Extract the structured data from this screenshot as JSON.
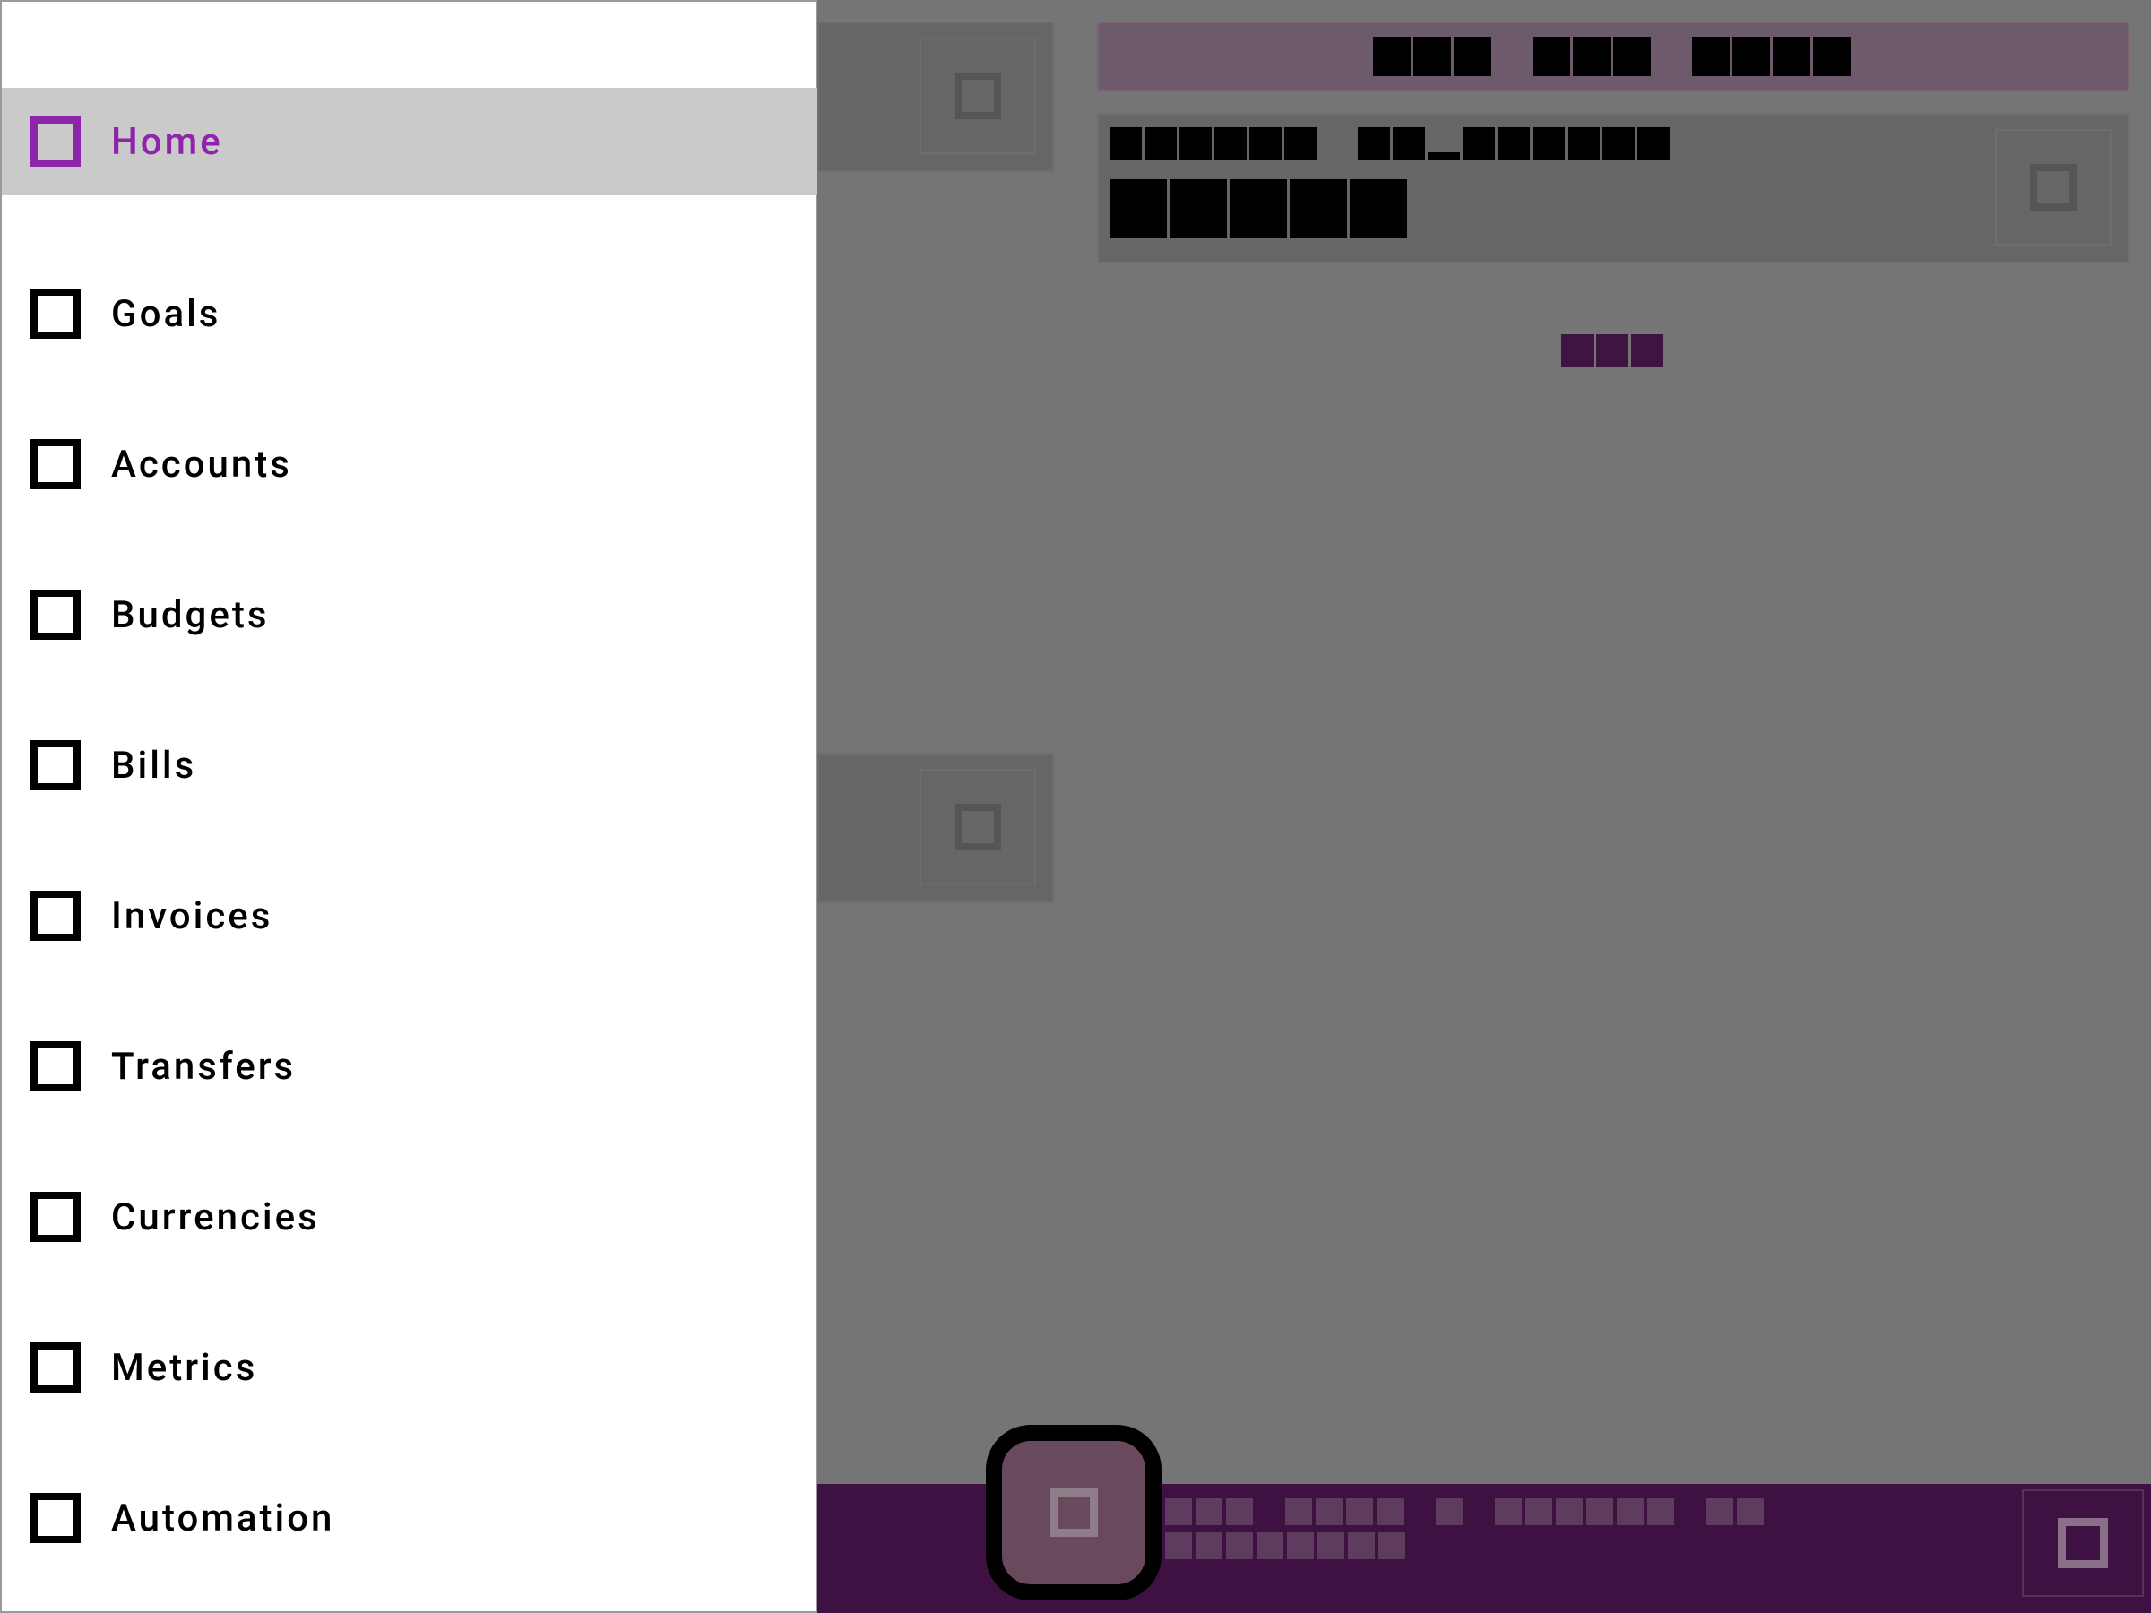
{
  "drawer": {
    "items": [
      {
        "label": "Home",
        "active": true
      },
      {
        "label": "Goals"
      },
      {
        "label": "Accounts"
      },
      {
        "label": "Budgets"
      },
      {
        "label": "Bills"
      },
      {
        "label": "Invoices"
      },
      {
        "label": "Transfers"
      },
      {
        "label": "Currencies"
      },
      {
        "label": "Metrics"
      },
      {
        "label": "Automation"
      }
    ]
  },
  "colors": {
    "accent": "#8e24aa",
    "active_item_bg": "#cacaca",
    "bottom_bar": "#3f1042",
    "scrim": "#757575"
  },
  "icons": {
    "nav": "square-icon",
    "fab": "add-icon",
    "cards": "square-icon"
  }
}
